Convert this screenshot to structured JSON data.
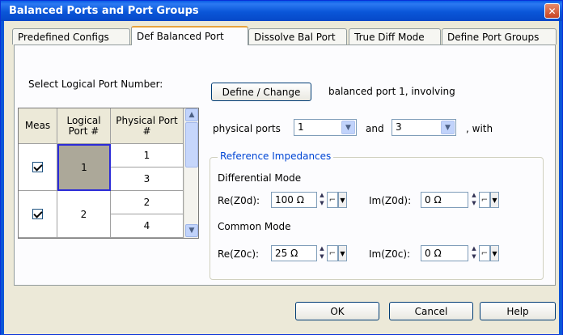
{
  "window": {
    "title": "Balanced Ports and Port Groups",
    "close_glyph": "✕"
  },
  "tabs": [
    {
      "label": "Predefined Configs"
    },
    {
      "label": "Def Balanced Port"
    },
    {
      "label": "Dissolve Bal Port"
    },
    {
      "label": "True Diff Mode"
    },
    {
      "label": "Define Port Groups"
    }
  ],
  "select_label": "Select Logical Port Number:",
  "table": {
    "headers": [
      "Meas",
      "Logical Port #",
      "Physical Port #"
    ],
    "rows": [
      {
        "meas": true,
        "logical": "1",
        "physical": [
          "1",
          "3"
        ]
      },
      {
        "meas": true,
        "logical": "2",
        "physical": [
          "2",
          "4"
        ]
      }
    ]
  },
  "define_button": "Define / Change",
  "involving_text": "balanced port 1, involving",
  "physical_ports_label": "physical ports",
  "physical_port_a": "1",
  "and_label": "and",
  "physical_port_b": "3",
  "with_label": ", with",
  "ref_group": {
    "title": "Reference Impedances",
    "diff_label": "Differential Mode",
    "re_z0d_label": "Re(Z0d):",
    "re_z0d": "100 Ω",
    "im_z0d_label": "Im(Z0d):",
    "im_z0d": "0 Ω",
    "common_label": "Common Mode",
    "re_z0c_label": "Re(Z0c):",
    "re_z0c": "25 Ω",
    "im_z0c_label": "Im(Z0c):",
    "im_z0c": "0 Ω"
  },
  "footer": {
    "ok": "OK",
    "cancel": "Cancel",
    "help": "Help"
  },
  "icons": {
    "spinner": "spinner-icon",
    "wizard": "step-icon",
    "dropdown": "chevron-down-icon"
  }
}
